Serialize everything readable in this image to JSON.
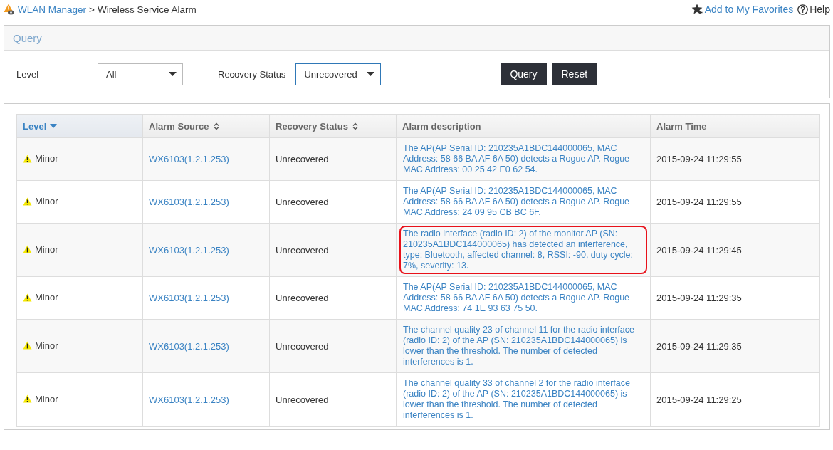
{
  "breadcrumb": {
    "root": "WLAN Manager",
    "separator": ">",
    "current": "Wireless Service Alarm"
  },
  "header_links": [
    {
      "kind": "favorite",
      "label": "Add to My Favorites"
    },
    {
      "kind": "help",
      "label": "Help"
    }
  ],
  "query": {
    "title": "Query",
    "fields": [
      {
        "label": "Level",
        "value": "All",
        "focused": false
      },
      {
        "label": "Recovery Status",
        "value": "Unrecovered",
        "focused": true
      }
    ],
    "buttons": [
      "Query",
      "Reset"
    ]
  },
  "table": {
    "columns": [
      {
        "label": "Level",
        "sortable": true,
        "sorted": true
      },
      {
        "label": "Alarm Source",
        "sortable": true,
        "sorted": false
      },
      {
        "label": "Recovery Status",
        "sortable": true,
        "sorted": false
      },
      {
        "label": "Alarm description",
        "sortable": false,
        "sorted": false
      },
      {
        "label": "Alarm Time",
        "sortable": false,
        "sorted": false
      }
    ],
    "rows": [
      {
        "level": "Minor",
        "source": "WX6103(1.2.1.253)",
        "status": "Unrecovered",
        "description": "The AP(AP Serial ID: 210235A1BDC144000065, MAC Address: 58 66 BA AF 6A 50) detects a Rogue AP. Rogue MAC Address: 00 25 42 E0 62 54.",
        "time": "2015-09-24 11:29:55",
        "highlighted": false
      },
      {
        "level": "Minor",
        "source": "WX6103(1.2.1.253)",
        "status": "Unrecovered",
        "description": "The AP(AP Serial ID: 210235A1BDC144000065, MAC Address: 58 66 BA AF 6A 50) detects a Rogue AP. Rogue MAC Address: 24 09 95 CB BC 6F.",
        "time": "2015-09-24 11:29:55",
        "highlighted": false
      },
      {
        "level": "Minor",
        "source": "WX6103(1.2.1.253)",
        "status": "Unrecovered",
        "description": "The radio interface (radio ID: 2) of the monitor AP (SN: 210235A1BDC144000065) has detected an interference, type: Bluetooth, affected channel: 8, RSSI: -90, duty cycle: 7%, severity: 13.",
        "time": "2015-09-24 11:29:45",
        "highlighted": true
      },
      {
        "level": "Minor",
        "source": "WX6103(1.2.1.253)",
        "status": "Unrecovered",
        "description": "The AP(AP Serial ID: 210235A1BDC144000065, MAC Address: 58 66 BA AF 6A 50) detects a Rogue AP. Rogue MAC Address: 74 1E 93 63 75 50.",
        "time": "2015-09-24 11:29:35",
        "highlighted": false
      },
      {
        "level": "Minor",
        "source": "WX6103(1.2.1.253)",
        "status": "Unrecovered",
        "description": "The channel quality 23 of channel 11 for the radio interface (radio ID: 2) of the AP (SN: 210235A1BDC144000065) is lower than the threshold. The number of detected interferences is 1.",
        "time": "2015-09-24 11:29:35",
        "highlighted": false
      },
      {
        "level": "Minor",
        "source": "WX6103(1.2.1.253)",
        "status": "Unrecovered",
        "description": "The channel quality 33 of channel 2 for the radio interface (radio ID: 2) of the AP (SN: 210235A1BDC144000065) is lower than the threshold. The number of detected interferences is 1.",
        "time": "2015-09-24 11:29:25",
        "highlighted": false
      }
    ]
  }
}
